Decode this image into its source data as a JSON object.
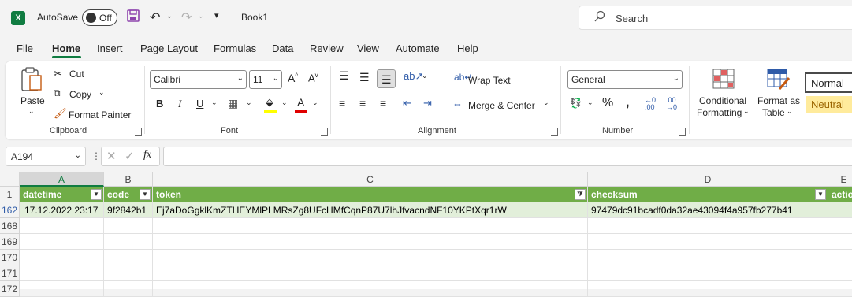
{
  "titlebar": {
    "autosave_label": "AutoSave",
    "autosave_state": "Off",
    "book_title": "Book1",
    "search_placeholder": "Search"
  },
  "tabs": [
    "File",
    "Home",
    "Insert",
    "Page Layout",
    "Formulas",
    "Data",
    "Review",
    "View",
    "Automate",
    "Help"
  ],
  "ribbon": {
    "clipboard": {
      "paste": "Paste",
      "cut": "Cut",
      "copy": "Copy",
      "format_painter": "Format Painter",
      "label": "Clipboard"
    },
    "font": {
      "family": "Calibri",
      "size": "11",
      "label": "Font"
    },
    "alignment": {
      "wrap_text": "Wrap Text",
      "merge_center": "Merge & Center",
      "label": "Alignment"
    },
    "number": {
      "format": "General",
      "label": "Number"
    },
    "styles": {
      "conditional_1": "Conditional",
      "conditional_2": "Formatting",
      "format_table_1": "Format as",
      "format_table_2": "Table",
      "normal": "Normal",
      "neutral": "Neutral"
    }
  },
  "formula_bar": {
    "name_box": "A194",
    "fx": "fx",
    "formula": ""
  },
  "grid": {
    "columns": [
      "A",
      "B",
      "C",
      "D",
      "E"
    ],
    "header_row": {
      "row_num": "1",
      "cells": [
        "datetime",
        "code",
        "token",
        "checksum",
        "actio"
      ]
    },
    "data_row": {
      "row_num": "162",
      "cells": [
        "17.12.2022 23:17",
        "9f2842b1",
        "Ej7aDoGgklKmZTHEYMlPLMRsZg8UFcHMfCqnP87U7lhJfvacndNF10YKPtXqr1rW",
        "97479dc91bcadf0da32ae43094f4a957fb277b41",
        ""
      ]
    },
    "empty_rows": [
      "168",
      "169",
      "170",
      "171",
      "172"
    ]
  },
  "colors": {
    "accent": "#107c41",
    "table_header": "#70ad47",
    "table_band": "#e2efda"
  }
}
